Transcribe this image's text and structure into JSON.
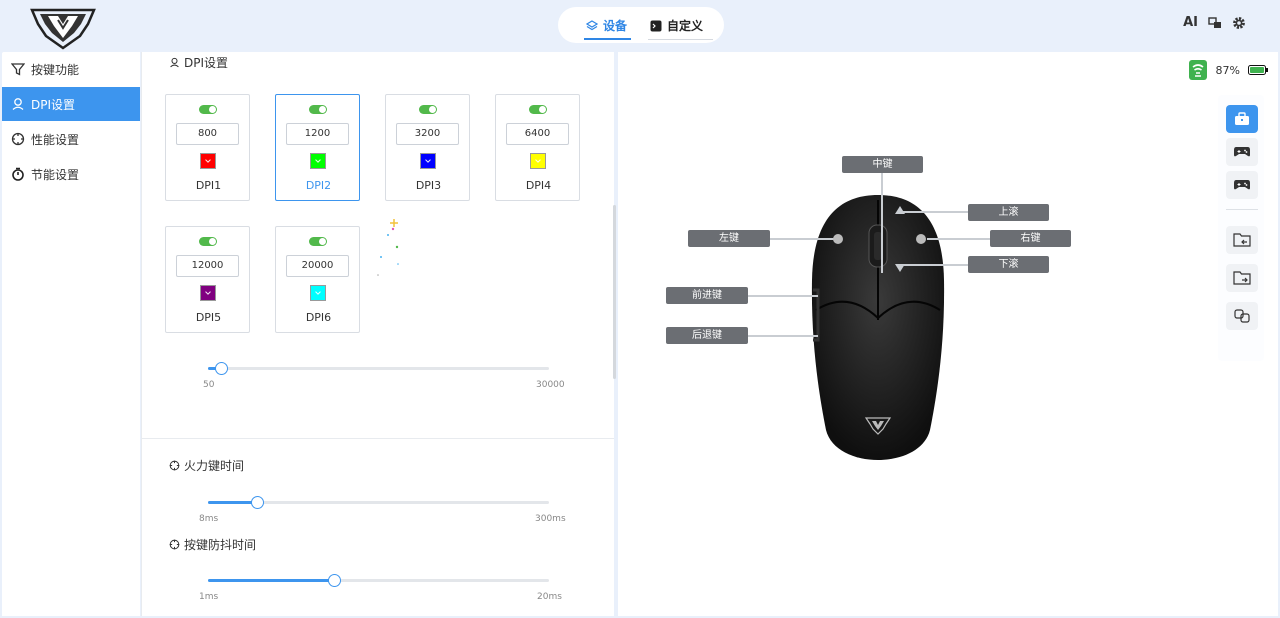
{
  "header": {
    "tabs": [
      {
        "label": "设备",
        "icon": "layers-icon",
        "active": true
      },
      {
        "label": "自定义",
        "icon": "terminal-icon",
        "active": false
      }
    ],
    "right_icons": {
      "ai": "AI",
      "translate": "translate-icon",
      "settings": "gear-icon"
    }
  },
  "sidebar": {
    "items": [
      {
        "label": "按键功能",
        "icon": "filter-icon",
        "active": false
      },
      {
        "label": "DPI设置",
        "icon": "location-icon",
        "active": true
      },
      {
        "label": "性能设置",
        "icon": "crosshair-icon",
        "active": false
      },
      {
        "label": "节能设置",
        "icon": "timer-icon",
        "active": false
      }
    ]
  },
  "dpi": {
    "title": "DPI设置",
    "cards": [
      {
        "value": "800",
        "label": "DPI1",
        "color": "#ff0000",
        "enabled": true
      },
      {
        "value": "1200",
        "label": "DPI2",
        "color": "#00ff00",
        "enabled": true,
        "selected": true
      },
      {
        "value": "3200",
        "label": "DPI3",
        "color": "#0000ff",
        "enabled": true
      },
      {
        "value": "6400",
        "label": "DPI4",
        "color": "#ffff00",
        "enabled": true
      },
      {
        "value": "12000",
        "label": "DPI5",
        "color": "#800080",
        "enabled": true
      },
      {
        "value": "20000",
        "label": "DPI6",
        "color": "#00ffff",
        "enabled": true
      }
    ],
    "slider": {
      "min": "50",
      "max": "30000",
      "value": 1200
    }
  },
  "fire_key": {
    "title": "火力键时间",
    "min": "8ms",
    "max": "300ms",
    "value": 50
  },
  "debounce": {
    "title": "按键防抖时间",
    "min": "1ms",
    "max": "20ms",
    "value": 8
  },
  "status": {
    "battery": "87%"
  },
  "mouse_labels": {
    "middle": "中键",
    "scroll_up": "上滚",
    "left": "左键",
    "right": "右键",
    "scroll_down": "下滚",
    "forward": "前进键",
    "back": "后退键"
  },
  "colors": {
    "accent": "#3d95ee",
    "toggle_on": "#52b94b",
    "background": "#e9f0fb"
  }
}
